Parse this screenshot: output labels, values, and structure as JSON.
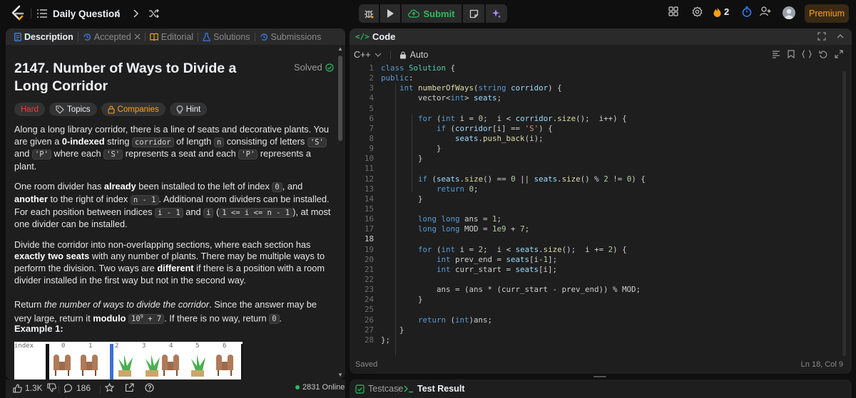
{
  "topbar": {
    "title": "Daily Question",
    "submit_label": "Submit",
    "streak_count": "2",
    "premium_label": "Premium"
  },
  "left_tabs": [
    {
      "label": "Description"
    },
    {
      "label": "Accepted"
    },
    {
      "label": "Editorial"
    },
    {
      "label": "Solutions"
    },
    {
      "label": "Submissions"
    }
  ],
  "problem": {
    "title": "2147. Number of Ways to Divide a Long Corridor",
    "status": "Solved",
    "chips": [
      "Hard",
      "Topics",
      "Companies",
      "Hint"
    ],
    "p1": [
      "Along a long library corridor, there is a line of seats and decorative plants. You are given a ",
      "0-indexed",
      " string ",
      "corridor",
      " of length ",
      "n",
      " consisting of letters ",
      "'S'",
      " and ",
      "'P'",
      " where each ",
      "'S'",
      " represents a seat and each ",
      "'P'",
      " represents a plant."
    ],
    "p2": [
      "One room divider has ",
      "already",
      " been installed to the left of index ",
      "0",
      ", and ",
      "another",
      " to the right of index ",
      "n - 1",
      ". Additional room dividers can be installed. For each position between indices ",
      "i - 1",
      " and ",
      "i",
      " (",
      "1 <= i <= n - 1",
      "), at most one divider can be installed."
    ],
    "p3": [
      "Divide the corridor into non-overlapping sections, where each section has ",
      "exactly two seats",
      " with any number of plants. There may be multiple ways to perform the division. Two ways are ",
      "different",
      " if there is a position with a room divider installed in the first way but not in the second way."
    ],
    "p4": [
      "Return ",
      "the number of ways to divide the corridor",
      ". Since the answer may be very large, return it ",
      "modulo",
      " ",
      "10",
      "9",
      " + 7",
      ". If there is no way, return ",
      "0",
      "."
    ],
    "example_title": "Example 1:",
    "example_header": [
      "index",
      "0",
      "1",
      "2",
      "3",
      "4",
      "5",
      "6"
    ]
  },
  "bottom_left": {
    "likes": "1.3K",
    "comments": "186",
    "online": "2831 Online"
  },
  "code_panel": {
    "title": "Code",
    "tag": "</>",
    "language": "C++",
    "mode": "Auto",
    "saved": "Saved",
    "cursor": "Ln 18, Col 9",
    "current_line": 18
  },
  "code_lines": [
    [
      [
        "kw",
        "class"
      ],
      [
        "",
        ""
      ],
      [
        "ty",
        " Solution"
      ],
      [
        "",
        " {"
      ]
    ],
    [
      [
        "kw",
        "public"
      ],
      [
        "",
        ":"
      ]
    ],
    [
      [
        "",
        ""
      ],
      [
        "kw",
        "    int"
      ],
      [
        "fn",
        " numberOfWays"
      ],
      [
        "",
        "("
      ],
      [
        "kw",
        "string"
      ],
      [
        "var",
        " corridor"
      ],
      [
        "",
        ") {"
      ]
    ],
    [
      [
        "",
        "        vector<"
      ],
      [
        "kw",
        "int"
      ],
      [
        "",
        "> "
      ],
      [
        "var",
        "seats"
      ],
      [
        "",
        ";"
      ]
    ],
    [
      [
        "",
        ""
      ]
    ],
    [
      [
        "kw",
        "        for"
      ],
      [
        "",
        " ("
      ],
      [
        "kw",
        "int"
      ],
      [
        "",
        " i = "
      ],
      [
        "num",
        "0"
      ],
      [
        "",
        ";  i < "
      ],
      [
        "var",
        "corridor"
      ],
      [
        "",
        "."
      ],
      [
        "fn",
        "size"
      ],
      [
        "",
        "();  i++) {"
      ]
    ],
    [
      [
        "kw",
        "            if"
      ],
      [
        "",
        " ("
      ],
      [
        "var",
        "corridor"
      ],
      [
        "",
        "[i] == "
      ],
      [
        "str",
        "'S'"
      ],
      [
        "",
        ") {"
      ]
    ],
    [
      [
        "",
        "                "
      ],
      [
        "var",
        "seats"
      ],
      [
        "",
        "."
      ],
      [
        "fn",
        "push_back"
      ],
      [
        "",
        "(i);"
      ]
    ],
    [
      [
        "",
        "            }"
      ]
    ],
    [
      [
        "",
        "        }"
      ]
    ],
    [
      [
        "",
        ""
      ]
    ],
    [
      [
        "kw",
        "        if"
      ],
      [
        "",
        " ("
      ],
      [
        "var",
        "seats"
      ],
      [
        "",
        "."
      ],
      [
        "fn",
        "size"
      ],
      [
        "",
        "() == "
      ],
      [
        "num",
        "0"
      ],
      [
        "",
        " || "
      ],
      [
        "var",
        "seats"
      ],
      [
        "",
        "."
      ],
      [
        "fn",
        "size"
      ],
      [
        "",
        "() % "
      ],
      [
        "num",
        "2"
      ],
      [
        "",
        " != "
      ],
      [
        "num",
        "0"
      ],
      [
        "",
        ") {"
      ]
    ],
    [
      [
        "kw",
        "            return"
      ],
      [
        "",
        " "
      ],
      [
        "num",
        "0"
      ],
      [
        "",
        ";"
      ]
    ],
    [
      [
        "",
        "        }"
      ]
    ],
    [
      [
        "",
        ""
      ]
    ],
    [
      [
        "kw",
        "        long long"
      ],
      [
        "",
        " ans = "
      ],
      [
        "num",
        "1"
      ],
      [
        "",
        ";"
      ]
    ],
    [
      [
        "kw",
        "        long long"
      ],
      [
        "",
        " MOD = "
      ],
      [
        "num",
        "1e9"
      ],
      [
        "",
        " + "
      ],
      [
        "num",
        "7"
      ],
      [
        "",
        ";"
      ]
    ],
    [
      [
        "",
        ""
      ]
    ],
    [
      [
        "kw",
        "        for"
      ],
      [
        "",
        " ("
      ],
      [
        "kw",
        "int"
      ],
      [
        "",
        " i = "
      ],
      [
        "num",
        "2"
      ],
      [
        "",
        ";  i < "
      ],
      [
        "var",
        "seats"
      ],
      [
        "",
        "."
      ],
      [
        "fn",
        "size"
      ],
      [
        "",
        "();  i += "
      ],
      [
        "num",
        "2"
      ],
      [
        "",
        ") {"
      ]
    ],
    [
      [
        "kw",
        "            int"
      ],
      [
        "",
        " prev_end = "
      ],
      [
        "var",
        "seats"
      ],
      [
        "",
        "[i-"
      ],
      [
        "num",
        "1"
      ],
      [
        "",
        "];"
      ]
    ],
    [
      [
        "kw",
        "            int"
      ],
      [
        "",
        " curr_start = "
      ],
      [
        "var",
        "seats"
      ],
      [
        "",
        "[i];"
      ]
    ],
    [
      [
        "",
        ""
      ]
    ],
    [
      [
        "",
        "            ans = (ans * (curr_start - prev_end)) % MOD;"
      ]
    ],
    [
      [
        "",
        "        }"
      ]
    ],
    [
      [
        "",
        ""
      ]
    ],
    [
      [
        "kw",
        "        return"
      ],
      [
        "",
        " ("
      ],
      [
        "kw",
        "int"
      ],
      [
        "",
        ")ans;"
      ]
    ],
    [
      [
        "",
        "    }"
      ]
    ],
    [
      [
        "",
        "};"
      ]
    ]
  ],
  "bottom_right": {
    "testcase": "Testcase",
    "test_result": "Test Result"
  },
  "colors": {
    "accent_orange": "#ffa116",
    "green": "#2cbb5d",
    "hard_red": "#f63737",
    "panel_bg": "#1e1e1e",
    "page_bg": "#0f0f0f"
  }
}
